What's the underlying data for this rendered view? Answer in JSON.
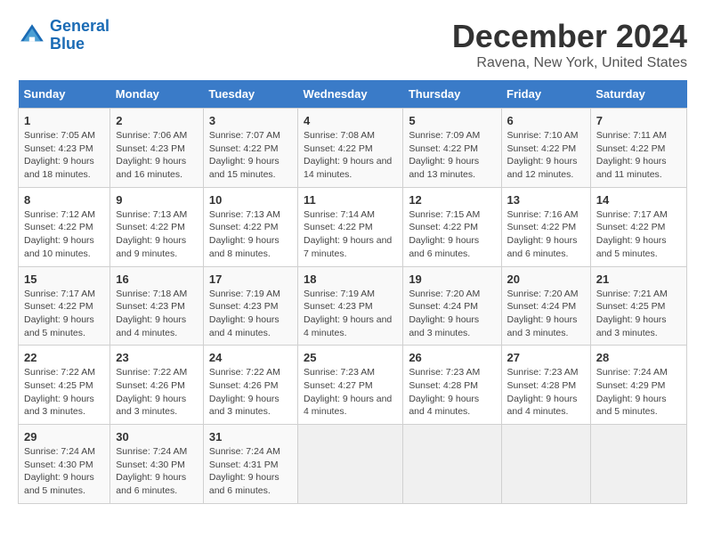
{
  "logo": {
    "line1": "General",
    "line2": "Blue"
  },
  "title": "December 2024",
  "subtitle": "Ravena, New York, United States",
  "days_header": [
    "Sunday",
    "Monday",
    "Tuesday",
    "Wednesday",
    "Thursday",
    "Friday",
    "Saturday"
  ],
  "weeks": [
    [
      {
        "day": "1",
        "info": "Sunrise: 7:05 AM\nSunset: 4:23 PM\nDaylight: 9 hours and 18 minutes."
      },
      {
        "day": "2",
        "info": "Sunrise: 7:06 AM\nSunset: 4:23 PM\nDaylight: 9 hours and 16 minutes."
      },
      {
        "day": "3",
        "info": "Sunrise: 7:07 AM\nSunset: 4:22 PM\nDaylight: 9 hours and 15 minutes."
      },
      {
        "day": "4",
        "info": "Sunrise: 7:08 AM\nSunset: 4:22 PM\nDaylight: 9 hours and 14 minutes."
      },
      {
        "day": "5",
        "info": "Sunrise: 7:09 AM\nSunset: 4:22 PM\nDaylight: 9 hours and 13 minutes."
      },
      {
        "day": "6",
        "info": "Sunrise: 7:10 AM\nSunset: 4:22 PM\nDaylight: 9 hours and 12 minutes."
      },
      {
        "day": "7",
        "info": "Sunrise: 7:11 AM\nSunset: 4:22 PM\nDaylight: 9 hours and 11 minutes."
      }
    ],
    [
      {
        "day": "8",
        "info": "Sunrise: 7:12 AM\nSunset: 4:22 PM\nDaylight: 9 hours and 10 minutes."
      },
      {
        "day": "9",
        "info": "Sunrise: 7:13 AM\nSunset: 4:22 PM\nDaylight: 9 hours and 9 minutes."
      },
      {
        "day": "10",
        "info": "Sunrise: 7:13 AM\nSunset: 4:22 PM\nDaylight: 9 hours and 8 minutes."
      },
      {
        "day": "11",
        "info": "Sunrise: 7:14 AM\nSunset: 4:22 PM\nDaylight: 9 hours and 7 minutes."
      },
      {
        "day": "12",
        "info": "Sunrise: 7:15 AM\nSunset: 4:22 PM\nDaylight: 9 hours and 6 minutes."
      },
      {
        "day": "13",
        "info": "Sunrise: 7:16 AM\nSunset: 4:22 PM\nDaylight: 9 hours and 6 minutes."
      },
      {
        "day": "14",
        "info": "Sunrise: 7:17 AM\nSunset: 4:22 PM\nDaylight: 9 hours and 5 minutes."
      }
    ],
    [
      {
        "day": "15",
        "info": "Sunrise: 7:17 AM\nSunset: 4:22 PM\nDaylight: 9 hours and 5 minutes."
      },
      {
        "day": "16",
        "info": "Sunrise: 7:18 AM\nSunset: 4:23 PM\nDaylight: 9 hours and 4 minutes."
      },
      {
        "day": "17",
        "info": "Sunrise: 7:19 AM\nSunset: 4:23 PM\nDaylight: 9 hours and 4 minutes."
      },
      {
        "day": "18",
        "info": "Sunrise: 7:19 AM\nSunset: 4:23 PM\nDaylight: 9 hours and 4 minutes."
      },
      {
        "day": "19",
        "info": "Sunrise: 7:20 AM\nSunset: 4:24 PM\nDaylight: 9 hours and 3 minutes."
      },
      {
        "day": "20",
        "info": "Sunrise: 7:20 AM\nSunset: 4:24 PM\nDaylight: 9 hours and 3 minutes."
      },
      {
        "day": "21",
        "info": "Sunrise: 7:21 AM\nSunset: 4:25 PM\nDaylight: 9 hours and 3 minutes."
      }
    ],
    [
      {
        "day": "22",
        "info": "Sunrise: 7:22 AM\nSunset: 4:25 PM\nDaylight: 9 hours and 3 minutes."
      },
      {
        "day": "23",
        "info": "Sunrise: 7:22 AM\nSunset: 4:26 PM\nDaylight: 9 hours and 3 minutes."
      },
      {
        "day": "24",
        "info": "Sunrise: 7:22 AM\nSunset: 4:26 PM\nDaylight: 9 hours and 3 minutes."
      },
      {
        "day": "25",
        "info": "Sunrise: 7:23 AM\nSunset: 4:27 PM\nDaylight: 9 hours and 4 minutes."
      },
      {
        "day": "26",
        "info": "Sunrise: 7:23 AM\nSunset: 4:28 PM\nDaylight: 9 hours and 4 minutes."
      },
      {
        "day": "27",
        "info": "Sunrise: 7:23 AM\nSunset: 4:28 PM\nDaylight: 9 hours and 4 minutes."
      },
      {
        "day": "28",
        "info": "Sunrise: 7:24 AM\nSunset: 4:29 PM\nDaylight: 9 hours and 5 minutes."
      }
    ],
    [
      {
        "day": "29",
        "info": "Sunrise: 7:24 AM\nSunset: 4:30 PM\nDaylight: 9 hours and 5 minutes."
      },
      {
        "day": "30",
        "info": "Sunrise: 7:24 AM\nSunset: 4:30 PM\nDaylight: 9 hours and 6 minutes."
      },
      {
        "day": "31",
        "info": "Sunrise: 7:24 AM\nSunset: 4:31 PM\nDaylight: 9 hours and 6 minutes."
      },
      null,
      null,
      null,
      null
    ]
  ]
}
